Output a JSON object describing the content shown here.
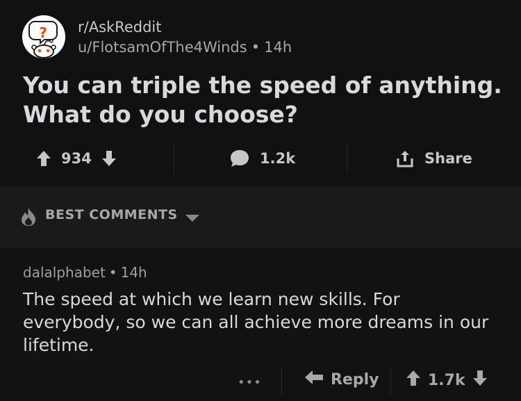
{
  "post": {
    "subreddit": "r/AskReddit",
    "author": "u/FlotsamOfThe4Winds",
    "age": "14h",
    "title": "You can triple the speed of anything. What do you choose?",
    "icon": "askreddit-snoo-icon"
  },
  "actions": {
    "score": "934",
    "comments": "1.2k",
    "share_label": "Share"
  },
  "sort": {
    "label": "BEST COMMENTS"
  },
  "comment": {
    "author": "dalalphabet",
    "age": "14h",
    "body": "The speed at which we learn new skills. For everybody, so we can all achieve more dreams in our lifetime.",
    "more_label": "•••",
    "reply_label": "Reply",
    "score": "1.7k"
  },
  "colors": {
    "background": "#121212",
    "sort_bar": "#1a1a1b",
    "text": "#d7dadc",
    "muted": "#a8a8a8",
    "askreddit_orange": "#ff4500"
  }
}
